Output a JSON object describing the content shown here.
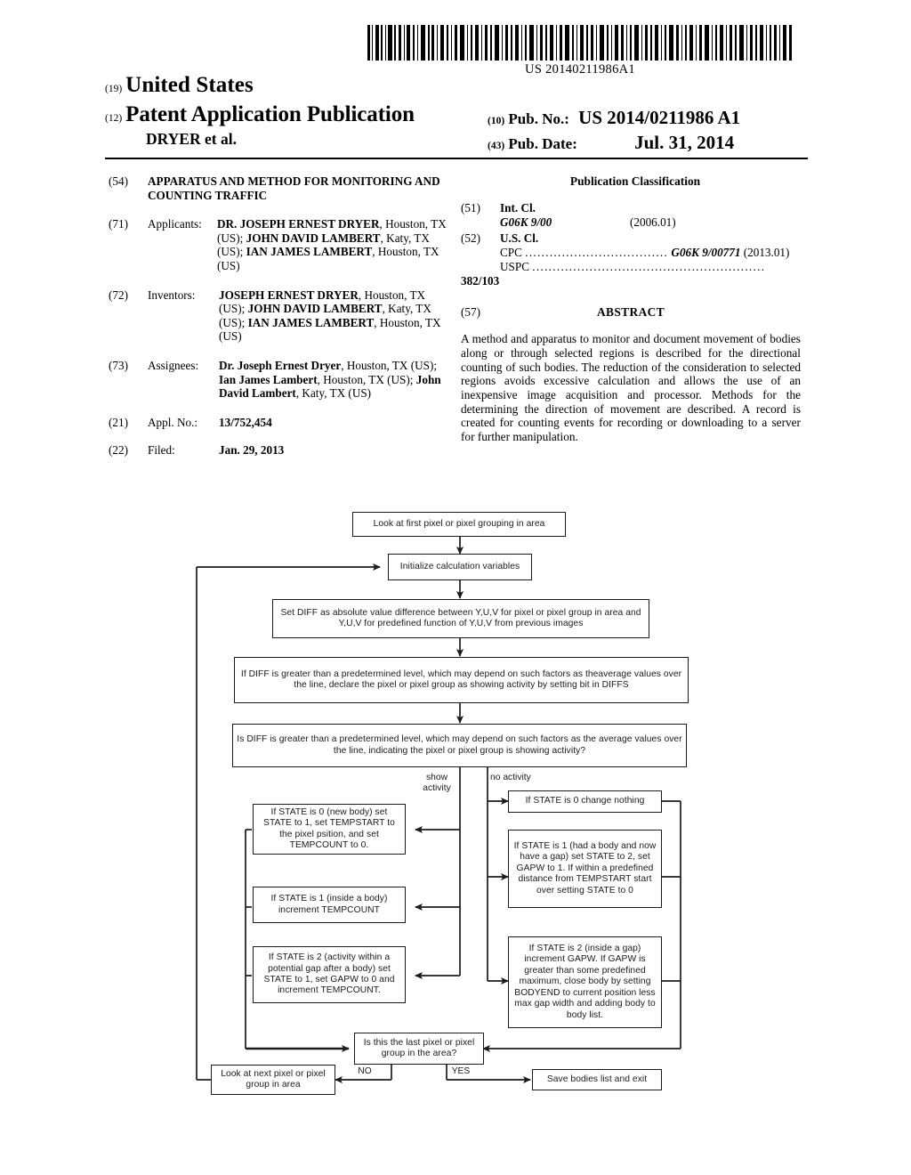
{
  "barcode": {
    "number": "US 20140211986A1",
    "icon": "barcode-icon"
  },
  "header": {
    "code_19": "(19)",
    "country": "United States",
    "code_12": "(12)",
    "doc_type": "Patent Application Publication",
    "authors": "DRYER et al.",
    "code_10": "(10)",
    "pubno_label": "Pub. No.:",
    "pubno_value": "US 2014/0211986 A1",
    "code_43": "(43)",
    "pubdate_label": "Pub. Date:",
    "pubdate_value": "Jul. 31, 2014"
  },
  "biblio": {
    "title_num": "(54)",
    "title": "APPARATUS AND METHOD FOR MONITORING AND COUNTING TRAFFIC",
    "applicants_num": "(71)",
    "applicants_label": "Applicants:",
    "applicants_value": "DR. JOSEPH ERNEST DRYER, Houston, TX (US); JOHN DAVID LAMBERT, Katy, TX (US); IAN JAMES LAMBERT, Houston, TX (US)",
    "inventors_num": "(72)",
    "inventors_label": "Inventors:",
    "inventors_value": "JOSEPH ERNEST DRYER, Houston, TX (US); JOHN DAVID LAMBERT, Katy, TX (US); IAN JAMES LAMBERT, Houston, TX (US)",
    "assignees_num": "(73)",
    "assignees_label": "Assignees:",
    "assignees_value": "Dr. Joseph Ernest Dryer, Houston, TX (US); Ian James Lambert, Houston, TX (US); John David Lambert, Katy, TX (US)",
    "applno_num": "(21)",
    "applno_label": "Appl. No.:",
    "applno_value": "13/752,454",
    "filed_num": "(22)",
    "filed_label": "Filed:",
    "filed_value": "Jan. 29, 2013"
  },
  "classification": {
    "heading": "Publication Classification",
    "intcl_num": "(51)",
    "intcl_label": "Int. Cl.",
    "intcl_code": "G06K 9/00",
    "intcl_date": "(2006.01)",
    "uscl_num": "(52)",
    "uscl_label": "U.S. Cl.",
    "cpc_label": "CPC",
    "cpc_dots": "...................................",
    "cpc_value": "G06K 9/00771",
    "cpc_date": "(2013.01)",
    "uspc_label": "USPC",
    "uspc_dots": ".........................................................",
    "uspc_value": "382/103"
  },
  "abstract": {
    "num": "(57)",
    "heading": "ABSTRACT",
    "text": "A method and apparatus to monitor and document movement of bodies along or through selected regions is described for the directional counting of such bodies. The reduction of the consideration to selected regions avoids excessive calculation and allows the use of an inexpensive image acquisition and processor. Methods for the determining the direction of movement are described. A record is created for counting events for recording or downloading to a server for further manipulation."
  },
  "flowchart": {
    "boxes": {
      "start": "Look at first pixel or pixel grouping in area",
      "init": "Initialize calculation variables",
      "setdiff": "Set DIFF as absolute value difference between Y,U,V for pixel or pixel group in area and Y,U,V for predefined function of Y,U,V from previous images",
      "declare": "If DIFF is greater than a predetermined level, which may depend on such factors as theaverage  values over the line, declare the pixel or pixel group as showing activity by setting bit in DIFFS",
      "decision": "Is DIFF is greater than a predetermined level, which may depend on such factors as  the average values over the line, indicating the pixel or pixel group is showing activity?",
      "state0_active": "If STATE is 0 (new body) set STATE to 1, set TEMPSTART to the pixel psition, and set TEMPCOUNT to 0.",
      "state1_active": "If STATE is 1 (inside a body) increment TEMPCOUNT",
      "state2_active": "If STATE is 2 (activity within a potential gap after a body) set STATE to 1, set GAPW to 0 and increment TEMPCOUNT.",
      "state0_idle": "If STATE is 0 change nothing",
      "state1_idle": "If STATE is 1 (had a body and now have a gap) set STATE to 2, set GAPW to 1.  If within a predefined distance from TEMPSTART start over setting STATE to 0",
      "state2_idle": "If STATE is 2 (inside a gap) increment GAPW. If GAPW is greater than some predefined maximum, close body by setting BODYEND to current position less max gap width and adding body to body list.",
      "lastpixel": "Is this the last pixel  or pixel group in the area?",
      "nextpixel": "Look at next pixel or pixel group in area",
      "save": "Save bodies list and exit"
    },
    "labels": {
      "show_activity": "show\nactivity",
      "no_activity": "no activity",
      "no": "NO",
      "yes": "YES"
    }
  }
}
